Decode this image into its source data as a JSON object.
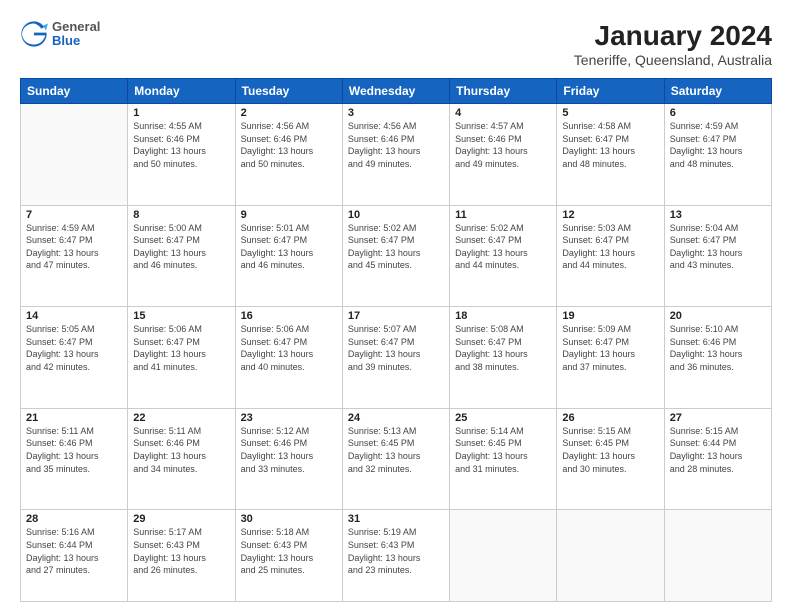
{
  "header": {
    "logo": {
      "general": "General",
      "blue": "Blue"
    },
    "title": "January 2024",
    "subtitle": "Teneriffe, Queensland, Australia"
  },
  "calendar": {
    "days_of_week": [
      "Sunday",
      "Monday",
      "Tuesday",
      "Wednesday",
      "Thursday",
      "Friday",
      "Saturday"
    ],
    "weeks": [
      [
        {
          "day": "",
          "info": ""
        },
        {
          "day": "1",
          "info": "Sunrise: 4:55 AM\nSunset: 6:46 PM\nDaylight: 13 hours\nand 50 minutes."
        },
        {
          "day": "2",
          "info": "Sunrise: 4:56 AM\nSunset: 6:46 PM\nDaylight: 13 hours\nand 50 minutes."
        },
        {
          "day": "3",
          "info": "Sunrise: 4:56 AM\nSunset: 6:46 PM\nDaylight: 13 hours\nand 49 minutes."
        },
        {
          "day": "4",
          "info": "Sunrise: 4:57 AM\nSunset: 6:46 PM\nDaylight: 13 hours\nand 49 minutes."
        },
        {
          "day": "5",
          "info": "Sunrise: 4:58 AM\nSunset: 6:47 PM\nDaylight: 13 hours\nand 48 minutes."
        },
        {
          "day": "6",
          "info": "Sunrise: 4:59 AM\nSunset: 6:47 PM\nDaylight: 13 hours\nand 48 minutes."
        }
      ],
      [
        {
          "day": "7",
          "info": "Sunrise: 4:59 AM\nSunset: 6:47 PM\nDaylight: 13 hours\nand 47 minutes."
        },
        {
          "day": "8",
          "info": "Sunrise: 5:00 AM\nSunset: 6:47 PM\nDaylight: 13 hours\nand 46 minutes."
        },
        {
          "day": "9",
          "info": "Sunrise: 5:01 AM\nSunset: 6:47 PM\nDaylight: 13 hours\nand 46 minutes."
        },
        {
          "day": "10",
          "info": "Sunrise: 5:02 AM\nSunset: 6:47 PM\nDaylight: 13 hours\nand 45 minutes."
        },
        {
          "day": "11",
          "info": "Sunrise: 5:02 AM\nSunset: 6:47 PM\nDaylight: 13 hours\nand 44 minutes."
        },
        {
          "day": "12",
          "info": "Sunrise: 5:03 AM\nSunset: 6:47 PM\nDaylight: 13 hours\nand 44 minutes."
        },
        {
          "day": "13",
          "info": "Sunrise: 5:04 AM\nSunset: 6:47 PM\nDaylight: 13 hours\nand 43 minutes."
        }
      ],
      [
        {
          "day": "14",
          "info": "Sunrise: 5:05 AM\nSunset: 6:47 PM\nDaylight: 13 hours\nand 42 minutes."
        },
        {
          "day": "15",
          "info": "Sunrise: 5:06 AM\nSunset: 6:47 PM\nDaylight: 13 hours\nand 41 minutes."
        },
        {
          "day": "16",
          "info": "Sunrise: 5:06 AM\nSunset: 6:47 PM\nDaylight: 13 hours\nand 40 minutes."
        },
        {
          "day": "17",
          "info": "Sunrise: 5:07 AM\nSunset: 6:47 PM\nDaylight: 13 hours\nand 39 minutes."
        },
        {
          "day": "18",
          "info": "Sunrise: 5:08 AM\nSunset: 6:47 PM\nDaylight: 13 hours\nand 38 minutes."
        },
        {
          "day": "19",
          "info": "Sunrise: 5:09 AM\nSunset: 6:47 PM\nDaylight: 13 hours\nand 37 minutes."
        },
        {
          "day": "20",
          "info": "Sunrise: 5:10 AM\nSunset: 6:46 PM\nDaylight: 13 hours\nand 36 minutes."
        }
      ],
      [
        {
          "day": "21",
          "info": "Sunrise: 5:11 AM\nSunset: 6:46 PM\nDaylight: 13 hours\nand 35 minutes."
        },
        {
          "day": "22",
          "info": "Sunrise: 5:11 AM\nSunset: 6:46 PM\nDaylight: 13 hours\nand 34 minutes."
        },
        {
          "day": "23",
          "info": "Sunrise: 5:12 AM\nSunset: 6:46 PM\nDaylight: 13 hours\nand 33 minutes."
        },
        {
          "day": "24",
          "info": "Sunrise: 5:13 AM\nSunset: 6:45 PM\nDaylight: 13 hours\nand 32 minutes."
        },
        {
          "day": "25",
          "info": "Sunrise: 5:14 AM\nSunset: 6:45 PM\nDaylight: 13 hours\nand 31 minutes."
        },
        {
          "day": "26",
          "info": "Sunrise: 5:15 AM\nSunset: 6:45 PM\nDaylight: 13 hours\nand 30 minutes."
        },
        {
          "day": "27",
          "info": "Sunrise: 5:15 AM\nSunset: 6:44 PM\nDaylight: 13 hours\nand 28 minutes."
        }
      ],
      [
        {
          "day": "28",
          "info": "Sunrise: 5:16 AM\nSunset: 6:44 PM\nDaylight: 13 hours\nand 27 minutes."
        },
        {
          "day": "29",
          "info": "Sunrise: 5:17 AM\nSunset: 6:43 PM\nDaylight: 13 hours\nand 26 minutes."
        },
        {
          "day": "30",
          "info": "Sunrise: 5:18 AM\nSunset: 6:43 PM\nDaylight: 13 hours\nand 25 minutes."
        },
        {
          "day": "31",
          "info": "Sunrise: 5:19 AM\nSunset: 6:43 PM\nDaylight: 13 hours\nand 23 minutes."
        },
        {
          "day": "",
          "info": ""
        },
        {
          "day": "",
          "info": ""
        },
        {
          "day": "",
          "info": ""
        }
      ]
    ]
  }
}
